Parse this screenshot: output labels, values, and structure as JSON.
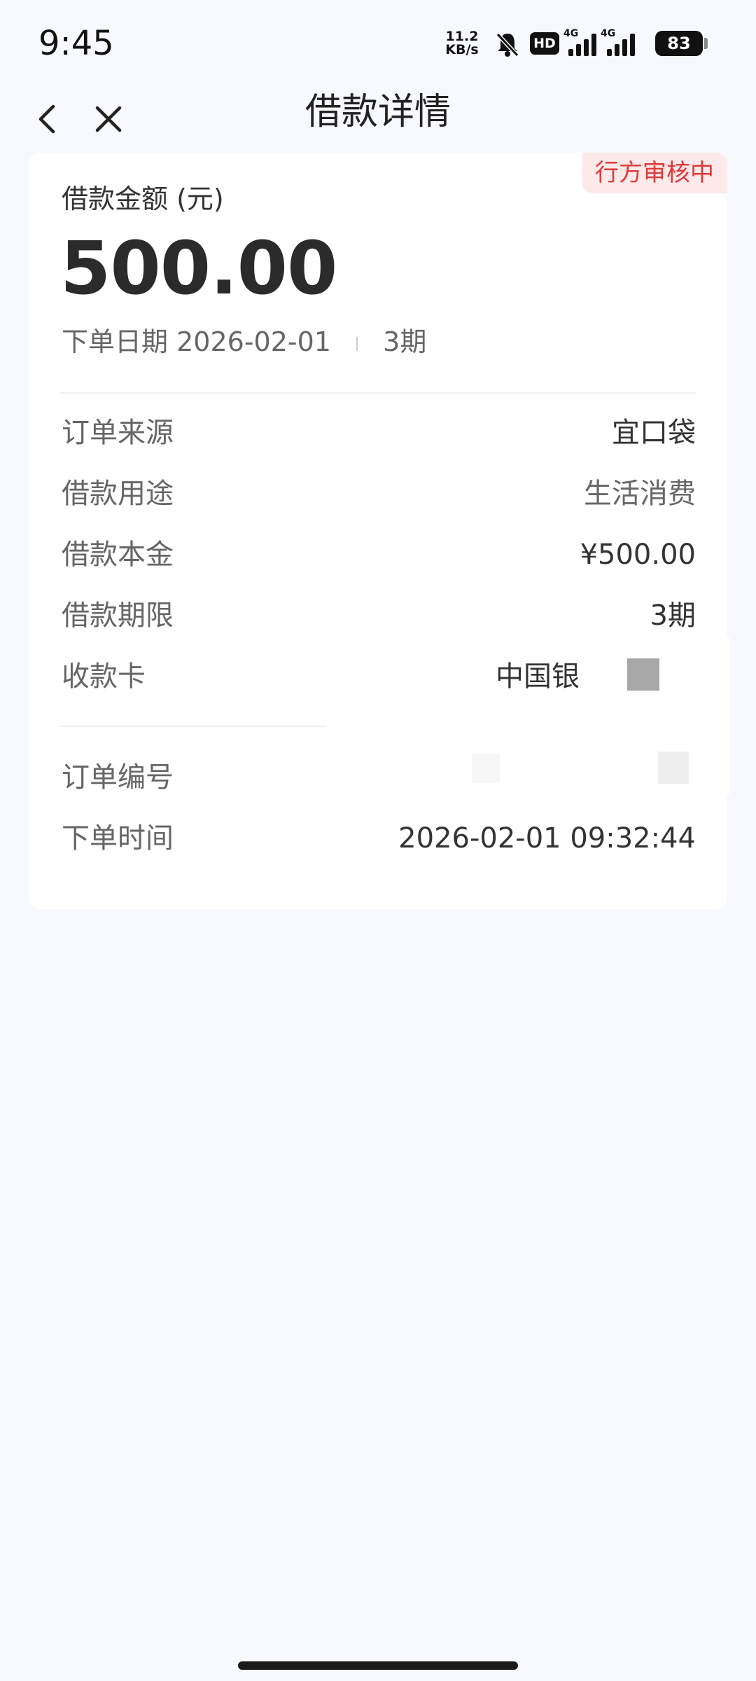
{
  "status_bar": {
    "time": "9:45",
    "net_speed_value": "11.2",
    "net_speed_unit": "KB/s",
    "hd_label": "HD",
    "network_1": "4G",
    "network_2": "4G",
    "battery": "83",
    "icons": [
      "mute-bell-icon",
      "hd-icon",
      "signal-icon",
      "signal-icon",
      "battery-icon"
    ]
  },
  "header": {
    "title": "借款详情",
    "back_icon": "chevron-left-icon",
    "close_icon": "close-icon"
  },
  "card": {
    "status_badge": "行方审核中",
    "amount_label": "借款金额 (元)",
    "amount_value": "500.00",
    "order_date_label": "下单日期",
    "order_date_value": "2026-02-01",
    "term_short": "3期",
    "details": [
      {
        "label": "订单来源",
        "value": "宜口袋"
      },
      {
        "label": "借款用途",
        "value": "生活消费"
      },
      {
        "label": "借款本金",
        "value": "¥500.00"
      },
      {
        "label": "借款期限",
        "value": "3期"
      },
      {
        "label": "收款卡",
        "value": "中国银"
      }
    ],
    "order_info": [
      {
        "label": "订单编号",
        "value": ""
      },
      {
        "label": "下单时间",
        "value": "2026-02-01 09:32:44"
      }
    ]
  },
  "colors": {
    "background": "#f8f9fe",
    "card": "#ffffff",
    "badge_bg": "#fde9e9",
    "badge_text": "#e03a3a",
    "primary_text": "#333333",
    "secondary_text": "#666666"
  }
}
